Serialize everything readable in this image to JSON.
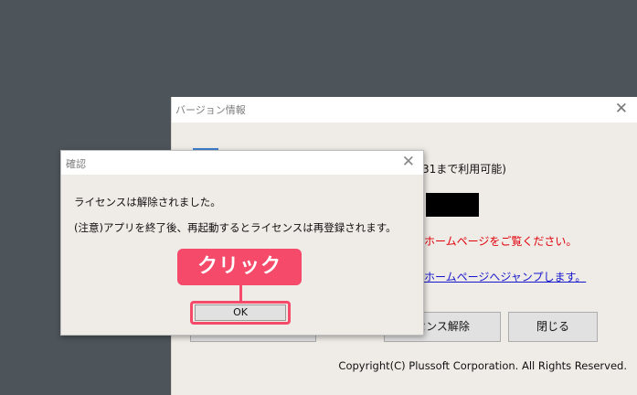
{
  "version_window": {
    "title": "バージョン情報",
    "availability_text": "31まで利用可能)",
    "notice_text": "ホームページをご覧ください。",
    "link_text": "ホームページへジャンプします。",
    "release_button_label": "センス解除",
    "close_button_label": "閉じる",
    "copyright": "Copyright(C) Plussoft Corporation. All Rights Reserved."
  },
  "confirm_dialog": {
    "title": "確認",
    "message_line1": "ライセンスは解除されました。",
    "message_line2": "(注意)アプリを終了後、再起動するとライセンスは再登録されます。",
    "ok_label": "OK"
  },
  "annotation": {
    "label": "クリック",
    "color": "#f54a6a"
  }
}
